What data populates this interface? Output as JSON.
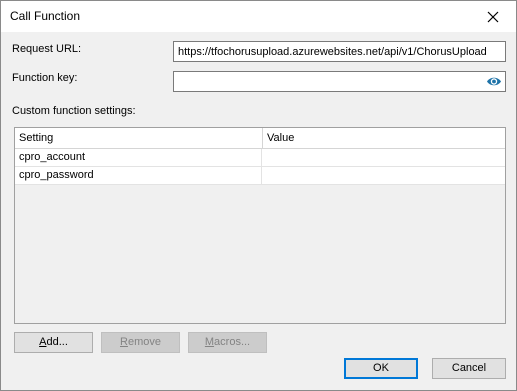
{
  "window": {
    "title": "Call Function"
  },
  "form": {
    "request_url_label": "Request URL:",
    "request_url_value": "https://tfochorusupload.azurewebsites.net/api/v1/ChorusUpload",
    "function_key_label": "Function key:",
    "function_key_value": "",
    "custom_settings_label": "Custom function settings:"
  },
  "table": {
    "columns": [
      "Setting",
      "Value"
    ],
    "rows": [
      {
        "setting": "cpro_account",
        "value": ""
      },
      {
        "setting": "cpro_password",
        "value": ""
      }
    ]
  },
  "buttons": {
    "add_prefix": "A",
    "add_rest": "dd...",
    "remove_prefix": "R",
    "remove_rest": "emove",
    "macros_prefix": "M",
    "macros_rest": "acros...",
    "ok": "OK",
    "cancel": "Cancel"
  },
  "icons": {
    "close": "close-icon",
    "eye": "eye-icon"
  },
  "colors": {
    "accent": "#0078d7",
    "eye": "#1e73a8"
  }
}
